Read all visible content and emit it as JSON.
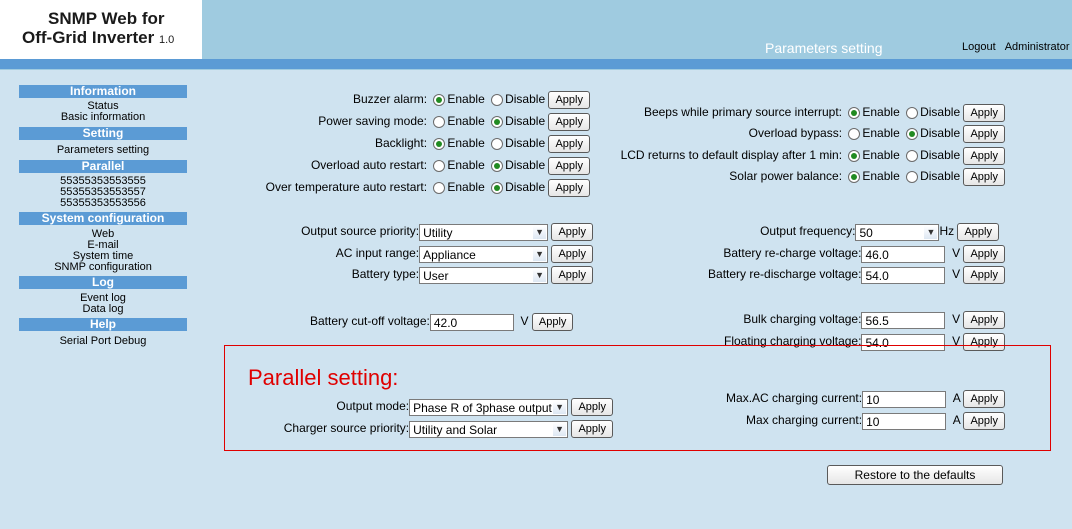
{
  "app": {
    "title_line1": "SNMP Web for",
    "title_line2": "Off-Grid Inverter",
    "version": "1.0"
  },
  "header": {
    "page_title": "Parameters setting",
    "logout": "Logout",
    "user": "Administrator"
  },
  "sidebar": {
    "information": "Information",
    "status": "Status",
    "basic_information": "Basic information",
    "setting": "Setting",
    "parameters_setting": "Parameters setting",
    "parallel": "Parallel",
    "parallel_ids": [
      "55355353553555",
      "55355353553557",
      "55355353553556"
    ],
    "system_configuration": "System configuration",
    "web": "Web",
    "email": "E-mail",
    "system_time": "System time",
    "snmp_configuration": "SNMP configuration",
    "log": "Log",
    "event_log": "Event log",
    "data_log": "Data log",
    "help": "Help",
    "serial_port_debug": "Serial Port Debug"
  },
  "radio": {
    "enable": "Enable",
    "disable": "Disable",
    "buzzer_alarm": "Buzzer alarm:",
    "power_saving_mode": "Power saving mode:",
    "backlight": "Backlight:",
    "overload_auto_restart": "Overload auto restart:",
    "over_temperature_auto_restart": "Over temperature auto restart:",
    "beeps_primary_interrupt": "Beeps while primary source interrupt:",
    "overload_bypass": "Overload bypass:",
    "lcd_returns_default": "LCD returns to default display after 1 min:",
    "solar_power_balance": "Solar power balance:"
  },
  "fields": {
    "output_source_priority": {
      "label": "Output source priority:",
      "value": "Utility"
    },
    "ac_input_range": {
      "label": "AC input range:",
      "value": "Appliance"
    },
    "battery_type": {
      "label": "Battery type:",
      "value": "User"
    },
    "output_frequency": {
      "label": "Output frequency:",
      "value": "50",
      "unit": "Hz"
    },
    "battery_recharge_voltage": {
      "label": "Battery re-charge voltage:",
      "value": "46.0",
      "unit": "V"
    },
    "battery_redischarge_voltage": {
      "label": "Battery re-discharge voltage:",
      "value": "54.0",
      "unit": "V"
    },
    "battery_cutoff_voltage": {
      "label": "Battery cut-off voltage:",
      "value": "42.0",
      "unit": "V"
    },
    "bulk_charging_voltage": {
      "label": "Bulk charging voltage:",
      "value": "56.5",
      "unit": "V"
    },
    "floating_charging_voltage": {
      "label": "Floating charging voltage:",
      "value": "54.0",
      "unit": "V"
    },
    "output_mode": {
      "label": "Output mode:",
      "value": "Phase R of 3phase output"
    },
    "charger_source_priority": {
      "label": "Charger source priority:",
      "value": "Utility and Solar"
    },
    "max_ac_charging_current": {
      "label": "Max.AC charging current:",
      "value": "10",
      "unit": "A"
    },
    "max_charging_current": {
      "label": "Max charging current:",
      "value": "10",
      "unit": "A"
    }
  },
  "buttons": {
    "apply": "Apply",
    "restore": "Restore to the defaults"
  },
  "parallel_title": "Parallel setting:"
}
